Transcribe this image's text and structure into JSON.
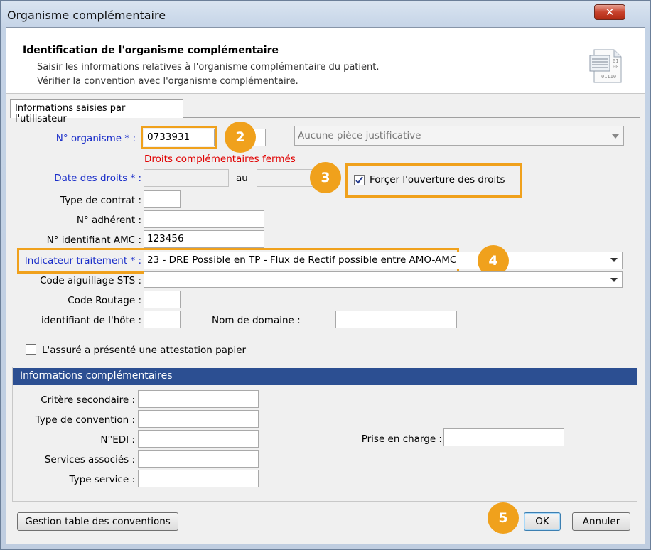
{
  "window": {
    "title": "Organisme complémentaire",
    "close_glyph": "✕"
  },
  "header": {
    "title": "Identification de l'organisme complémentaire",
    "line1": "Saisir les informations relatives à l'organisme complémentaire du patient.",
    "line2": "Vérifier la convention avec l'organisme complémentaire.",
    "icon": "document-binary-icon"
  },
  "tab": {
    "label": "Informations saisies par l'utilisateur"
  },
  "form": {
    "organisme_label": "N° organisme * :",
    "organisme_value": "0733931",
    "piece_value": "Aucune pièce justificative",
    "droits_error": "Droits complémentaires fermés",
    "date_label": "Date des droits * :",
    "date_au": "au",
    "forcer_label": "Forçer l'ouverture des droits",
    "forcer_checked": true,
    "contrat_label": "Type de contrat :",
    "adherent_label": "N° adhérent :",
    "amc_label": "N° identifiant AMC :",
    "amc_value": "123456",
    "indicateur_label": "Indicateur traitement * :",
    "indicateur_value": "23 - DRE Possible en TP - Flux de Rectif possible entre AMO-AMC",
    "aiguillage_label": "Code aiguillage STS :",
    "routage_label": "Code Routage :",
    "hote_label": "identifiant de l'hôte :",
    "domaine_label": "Nom de domaine :",
    "attestation_label": "L'assuré a présenté une attestation papier",
    "attestation_checked": false
  },
  "info": {
    "header": "Informations complémentaires",
    "critere_label": "Critère secondaire :",
    "convention_label": "Type de convention :",
    "edi_label": "N°EDI :",
    "services_label": "Services associés :",
    "service_label": "Type service :",
    "prise_label": "Prise en charge :"
  },
  "buttons": {
    "gestion": "Gestion table des conventions",
    "ok": "OK",
    "annuler": "Annuler"
  },
  "badges": [
    "2",
    "3",
    "4",
    "5"
  ],
  "colors": {
    "highlight": "#f0a11c",
    "label_blue": "#1a2ec9",
    "error_red": "#e00000",
    "section_header": "#2c4f92"
  }
}
